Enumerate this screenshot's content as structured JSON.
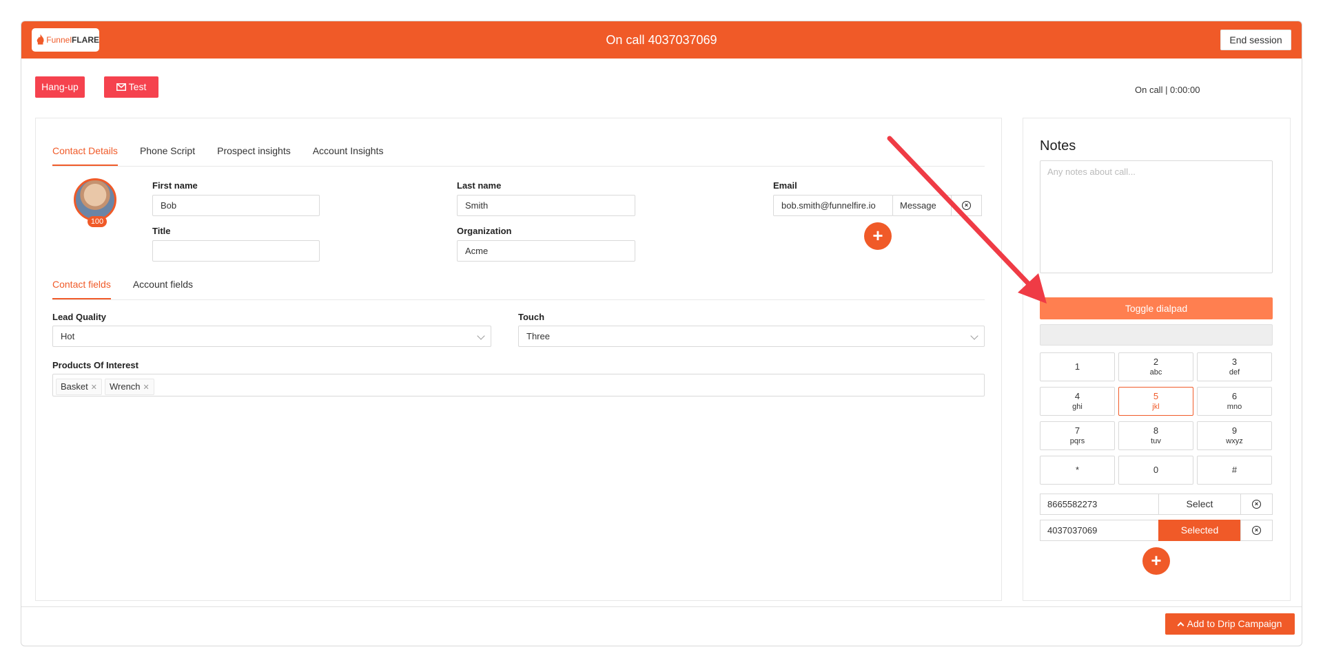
{
  "header": {
    "logo_text_1": "Funnel",
    "logo_text_2": "FLARE",
    "title": "On call 4037037069",
    "end_session": "End session"
  },
  "actions": {
    "hangup": "Hang-up",
    "test": "Test",
    "status": "On call | 0:00:00"
  },
  "contact_tabs": [
    {
      "label": "Contact Details",
      "active": true
    },
    {
      "label": "Phone Script",
      "active": false
    },
    {
      "label": "Prospect insights",
      "active": false
    },
    {
      "label": "Account Insights",
      "active": false
    }
  ],
  "contact": {
    "avatar_badge": "100",
    "first_name_label": "First name",
    "first_name": "Bob",
    "last_name_label": "Last name",
    "last_name": "Smith",
    "email_label": "Email",
    "email": "bob.smith@funnelfire.io",
    "message_btn": "Message",
    "title_label": "Title",
    "title": "",
    "org_label": "Organization",
    "organization": "Acme"
  },
  "field_tabs": [
    {
      "label": "Contact fields",
      "active": true
    },
    {
      "label": "Account fields",
      "active": false
    }
  ],
  "fields": {
    "lead_quality_label": "Lead Quality",
    "lead_quality": "Hot",
    "touch_label": "Touch",
    "touch": "Three",
    "products_label": "Products Of Interest",
    "products": [
      "Basket",
      "Wrench"
    ]
  },
  "notes": {
    "title": "Notes",
    "placeholder": "Any notes about call..."
  },
  "dialpad": {
    "toggle_label": "Toggle dialpad",
    "keys": [
      {
        "num": "1",
        "letters": ""
      },
      {
        "num": "2",
        "letters": "abc"
      },
      {
        "num": "3",
        "letters": "def"
      },
      {
        "num": "4",
        "letters": "ghi"
      },
      {
        "num": "5",
        "letters": "jkl"
      },
      {
        "num": "6",
        "letters": "mno"
      },
      {
        "num": "7",
        "letters": "pqrs"
      },
      {
        "num": "8",
        "letters": "tuv"
      },
      {
        "num": "9",
        "letters": "wxyz"
      },
      {
        "num": "*",
        "letters": ""
      },
      {
        "num": "0",
        "letters": ""
      },
      {
        "num": "#",
        "letters": ""
      }
    ],
    "selected_key": "5"
  },
  "phones": [
    {
      "number": "8665582273",
      "action": "Select",
      "selected": false
    },
    {
      "number": "4037037069",
      "action": "Selected",
      "selected": true
    }
  ],
  "footer": {
    "drip": "Add to Drip Campaign"
  },
  "colors": {
    "brand": "#f05a28",
    "danger": "#f5424e",
    "toggle": "#ff7f50"
  }
}
